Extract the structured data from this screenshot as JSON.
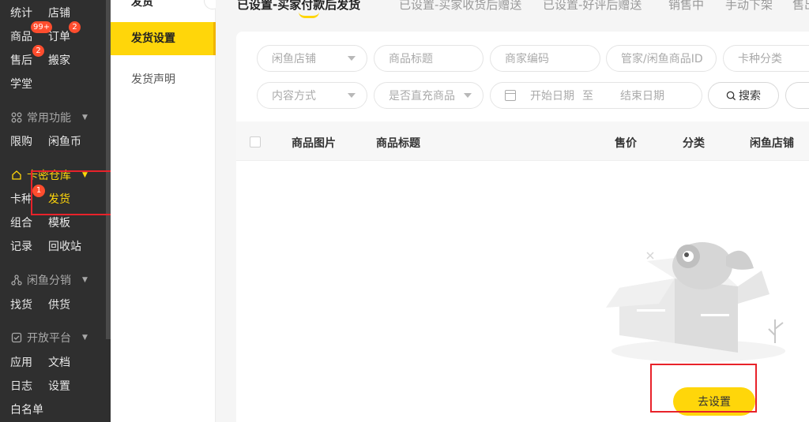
{
  "sidebar": {
    "row1": [
      "统计",
      "店铺"
    ],
    "row2": [
      "商品",
      "订单"
    ],
    "row2_badges": [
      "99+",
      "2"
    ],
    "row3": [
      "售后",
      "搬家"
    ],
    "row3_badge": "2",
    "row4": [
      "学堂"
    ],
    "group_common": "常用功能",
    "common_items": [
      "限购",
      "闲鱼币"
    ],
    "group_warehouse": "卡密仓库",
    "warehouse_row1": [
      "卡种",
      "发货"
    ],
    "warehouse_row2": [
      "组合",
      "模板"
    ],
    "warehouse_row3": [
      "记录",
      "回收站"
    ],
    "step_badge": "1",
    "group_distribution": "闲鱼分销",
    "distribution_items": [
      "找货",
      "供货"
    ],
    "group_open": "开放平台",
    "open_row1": [
      "应用",
      "文档"
    ],
    "open_row2": [
      "日志",
      "设置"
    ],
    "open_row3": [
      "白名单"
    ]
  },
  "submenu": {
    "cut_title": "发货",
    "items": [
      "发货设置",
      "发货声明"
    ]
  },
  "tabs": [
    "已设置-买家付款后发货",
    "已设置-买家收货后赠送",
    "已设置-好评后赠送",
    "销售中",
    "手动下架",
    "售出"
  ],
  "filters": {
    "shop": "闲鱼店铺",
    "title": "商品标题",
    "code": "商家编码",
    "id": "管家/闲鱼商品ID",
    "category": "卡种分类",
    "content": "内容方式",
    "direct": "是否直充商品",
    "start_date": "开始日期",
    "to": "至",
    "end_date": "结束日期",
    "search": "搜索"
  },
  "table": {
    "headers": [
      "商品图片",
      "商品标题",
      "售价",
      "分类",
      "闲鱼店铺"
    ]
  },
  "empty": {
    "button": "去设置"
  },
  "colors": {
    "accent": "#ffd60a",
    "sidebar_bg": "#2f2f2f",
    "highlight_box": "#e8222a",
    "badge": "#ff4d2e"
  }
}
